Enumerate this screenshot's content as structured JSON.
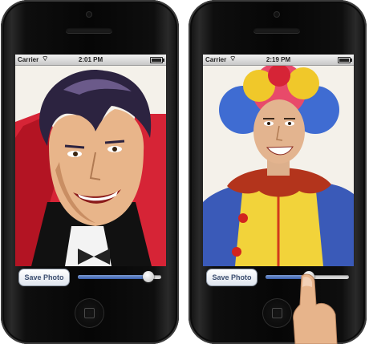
{
  "phones": [
    {
      "status_bar": {
        "carrier": "Carrier",
        "time": "2:01 PM"
      },
      "photo": {
        "description_icon": "vampire-costume-face",
        "background": "#f4f1ea"
      },
      "controls": {
        "save_label": "Save Photo",
        "slider_value": 0.85
      }
    },
    {
      "status_bar": {
        "carrier": "Carrier",
        "time": "2:19 PM"
      },
      "photo": {
        "description_icon": "clown-costume-face",
        "background": "#f4f1ea"
      },
      "controls": {
        "save_label": "Save Photo",
        "slider_value": 0.52
      }
    }
  ],
  "colors": {
    "slider_accent": "#3a5fae",
    "button_text": "#3a4c6e"
  }
}
